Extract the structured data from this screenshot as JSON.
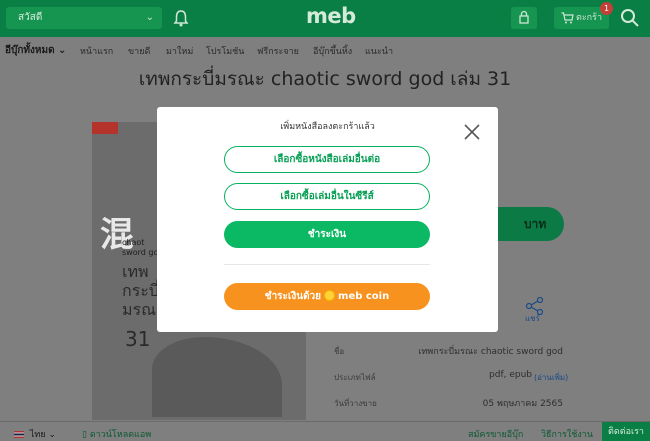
{
  "header": {
    "search_text": "สวัสดี",
    "logo": "meb",
    "cart_label": "ตะกร้า",
    "cart_count": "1"
  },
  "nav": {
    "all_books": "อีบุ๊กทั้งหมด",
    "items": [
      "หน้าแรก",
      "ขายดี",
      "มาใหม่",
      "โปรโมชัน",
      "ฟรีกระจาย",
      "อีบุ๊กขึ้นหิ้ง",
      "แนะนำ"
    ]
  },
  "book": {
    "title": "เทพกระบี่มรณะ chaotic sword god เล่ม 31",
    "cover_big": "混",
    "cover_en_line1": "chaot",
    "cover_en_line2": "sword go",
    "cover_th_line1": "เทพ",
    "cover_th_line2": "กระบี่",
    "cover_th_line3": "มรณะ",
    "cover_number": "31",
    "price_suffix": "บาท",
    "share_label": "แชร์",
    "info": [
      {
        "label": "ชื่อ",
        "value": "เทพกระบี่มรณะ chaotic sword god"
      },
      {
        "label": "ประเภทไฟล์",
        "value": "pdf, epub",
        "extra": "(อ่านเพิ่ม)"
      },
      {
        "label": "วันที่วางขาย",
        "value": "05 พฤษภาคม 2565"
      }
    ]
  },
  "modal": {
    "title": "เพิ่มหนังสือลงตะกร้าแล้ว",
    "btn_other_books": "เลือกซื้อหนังสือเล่มอื่นต่อ",
    "btn_series": "เลือกซื้อเล่มอื่นในซีรีส์",
    "btn_pay": "ชำระเงิน",
    "btn_coin_prefix": "ชำระเงินด้วย",
    "btn_coin_suffix": "meb coin"
  },
  "footer": {
    "language": "ไทย",
    "download": "ดาวน์โหลดแอพ",
    "register": "สมัครขายอีบุ๊ก",
    "howto": "วิธีการใช้งาน",
    "contact": "ติดต่อเรา"
  },
  "colors": {
    "brand_green": "#0bb863",
    "dark_green": "#0a7f45",
    "orange": "#f7921e",
    "overlay": "#7f7f7f"
  }
}
